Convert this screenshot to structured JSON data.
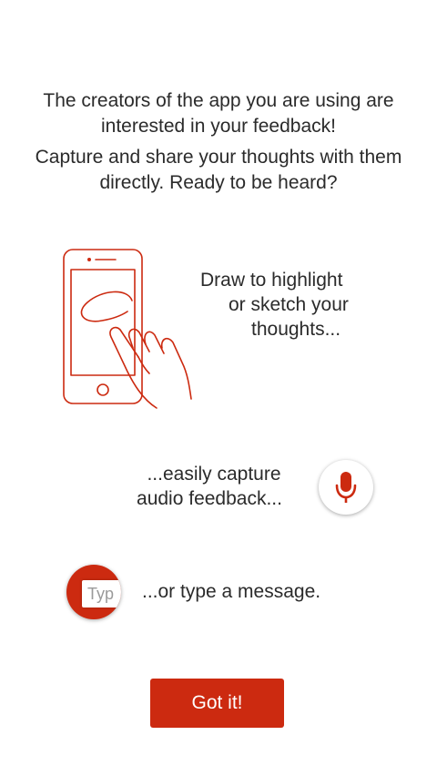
{
  "intro": {
    "line1": "The creators of the app you are using are interested in your feedback!",
    "line2": "Capture and share your thoughts with them directly. Ready to be heard?"
  },
  "draw": {
    "line1": "Draw to highlight",
    "line2": "or sketch your",
    "line3": "thoughts..."
  },
  "audio": {
    "line1": "...easily capture",
    "line2": "audio feedback...",
    "icon": "microphone-icon"
  },
  "type": {
    "text": "...or type a message.",
    "field_text": "Typ",
    "icon": "text-field-icon"
  },
  "button": {
    "label": "Got it!"
  },
  "colors": {
    "accent": "#cc2a10",
    "text": "#2b2b2b",
    "background": "#ffffff"
  }
}
